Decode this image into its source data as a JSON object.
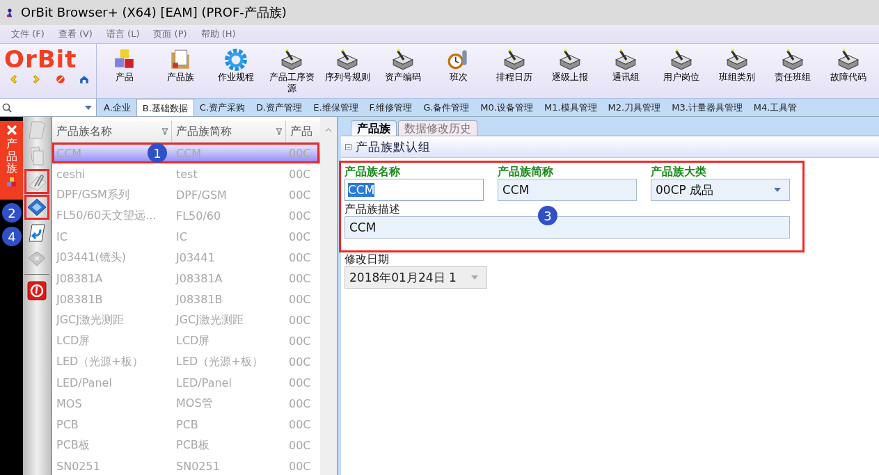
{
  "window": {
    "title": "OrBit Browser+ (X64) [EAM] (PROF-产品族)"
  },
  "menu": [
    "文件 (F)",
    "查看 (V)",
    "语言 (L)",
    "页面 (P)",
    "帮助 (H)"
  ],
  "logo": "OrBit",
  "toolbar": [
    {
      "label": "产品",
      "kind": "cubes"
    },
    {
      "label": "产品族",
      "kind": "folder"
    },
    {
      "label": "作业规程",
      "kind": "gear"
    },
    {
      "label": "产品工序资源",
      "kind": "box"
    },
    {
      "label": "序列号规则",
      "kind": "box"
    },
    {
      "label": "资产编码",
      "kind": "box"
    },
    {
      "label": "班次",
      "kind": "clock"
    },
    {
      "label": "排程日历",
      "kind": "box"
    },
    {
      "label": "逐级上报",
      "kind": "box"
    },
    {
      "label": "通讯组",
      "kind": "box"
    },
    {
      "label": "用户岗位",
      "kind": "box"
    },
    {
      "label": "班组类别",
      "kind": "box"
    },
    {
      "label": "责任班组",
      "kind": "box"
    },
    {
      "label": "故障代码",
      "kind": "box"
    }
  ],
  "module_tabs": [
    {
      "label": "A.企业",
      "selected": false
    },
    {
      "label": "B.基础数据",
      "selected": true
    },
    {
      "label": "C.资产采购",
      "selected": false
    },
    {
      "label": "D.资产管理",
      "selected": false
    },
    {
      "label": "E.维保管理",
      "selected": false
    },
    {
      "label": "F.维修管理",
      "selected": false
    },
    {
      "label": "G.备件管理",
      "selected": false
    },
    {
      "label": "M0.设备管理",
      "selected": false
    },
    {
      "label": "M1.模具管理",
      "selected": false
    },
    {
      "label": "M2.刀具管理",
      "selected": false
    },
    {
      "label": "M3.计量器具管理",
      "selected": false
    },
    {
      "label": "M4.工具管",
      "selected": false
    }
  ],
  "side_tab": {
    "label": "产品族"
  },
  "grid": {
    "columns": [
      "产品族名称",
      "产品族简称",
      "产品"
    ],
    "rows": [
      {
        "cells": [
          "CCM",
          "CCM",
          "00C"
        ],
        "selected": true
      },
      {
        "cells": [
          "ceshi",
          "test",
          "00C"
        ],
        "selected": false
      },
      {
        "cells": [
          "DPF/GSM系列",
          "DPF/GSM",
          "00C"
        ],
        "selected": false
      },
      {
        "cells": [
          "FL50/60天文望远...",
          "FL50/60",
          "00C"
        ],
        "selected": false
      },
      {
        "cells": [
          "IC",
          "IC",
          "00C"
        ],
        "selected": false
      },
      {
        "cells": [
          "J03441(镜头)",
          "J03441",
          "00C"
        ],
        "selected": false
      },
      {
        "cells": [
          "J08381A",
          "J08381A",
          "00C"
        ],
        "selected": false
      },
      {
        "cells": [
          "J08381B",
          "J08381B",
          "00C"
        ],
        "selected": false
      },
      {
        "cells": [
          "JGCJ激光测距",
          "JGCJ激光测距",
          "00C"
        ],
        "selected": false
      },
      {
        "cells": [
          "LCD屏",
          "LCD屏",
          "00C"
        ],
        "selected": false
      },
      {
        "cells": [
          "LED（光源+板）",
          "LED（光源+板）",
          "00C"
        ],
        "selected": false
      },
      {
        "cells": [
          "LED/Panel",
          "LED/Panel",
          "00C"
        ],
        "selected": false
      },
      {
        "cells": [
          "MOS",
          "MOS管",
          "00C"
        ],
        "selected": false
      },
      {
        "cells": [
          "PCB",
          "PCB",
          "00C"
        ],
        "selected": false
      },
      {
        "cells": [
          "PCB板",
          "PCB板",
          "00C"
        ],
        "selected": false
      },
      {
        "cells": [
          "SN0251",
          "SN0251",
          "00C"
        ],
        "selected": false
      }
    ]
  },
  "detail_tabs": [
    {
      "label": "产品族",
      "selected": true
    },
    {
      "label": "数据修改历史",
      "selected": false
    }
  ],
  "group": {
    "title": "产品族默认组",
    "expanded": true
  },
  "fields": [
    {
      "label": "产品族名称",
      "value": "CCM",
      "kind": "text",
      "required": true,
      "focused": true
    },
    {
      "label": "产品族简称",
      "value": "CCM",
      "kind": "text",
      "required": true,
      "focused": false
    },
    {
      "label": "产品族大类",
      "value": "00CP 成品",
      "kind": "select",
      "required": true,
      "focused": false
    },
    {
      "label": "产品族描述",
      "value": "CCM",
      "kind": "wide",
      "required": false,
      "focused": false
    }
  ],
  "date_field": {
    "label": "修改日期",
    "value": "2018年01月24日 1"
  },
  "callouts": [
    "1",
    "2",
    "3",
    "4"
  ]
}
